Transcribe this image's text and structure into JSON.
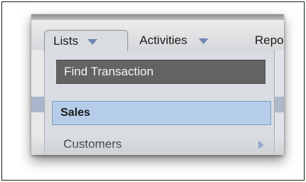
{
  "tabs": [
    {
      "label": "Lists",
      "icon": "dropdown-triangle-icon"
    },
    {
      "label": "Activities",
      "icon": "dropdown-triangle-icon"
    },
    {
      "label": "Repo"
    }
  ],
  "menu": {
    "find_label": "Find Transaction",
    "section_header": "Sales",
    "items": [
      {
        "label": "Customers",
        "icon": "submenu-arrow-icon"
      }
    ]
  },
  "colors": {
    "accent_triangle": "#6f86b4",
    "highlight": "#b5cde8",
    "find_bg": "#636363"
  }
}
